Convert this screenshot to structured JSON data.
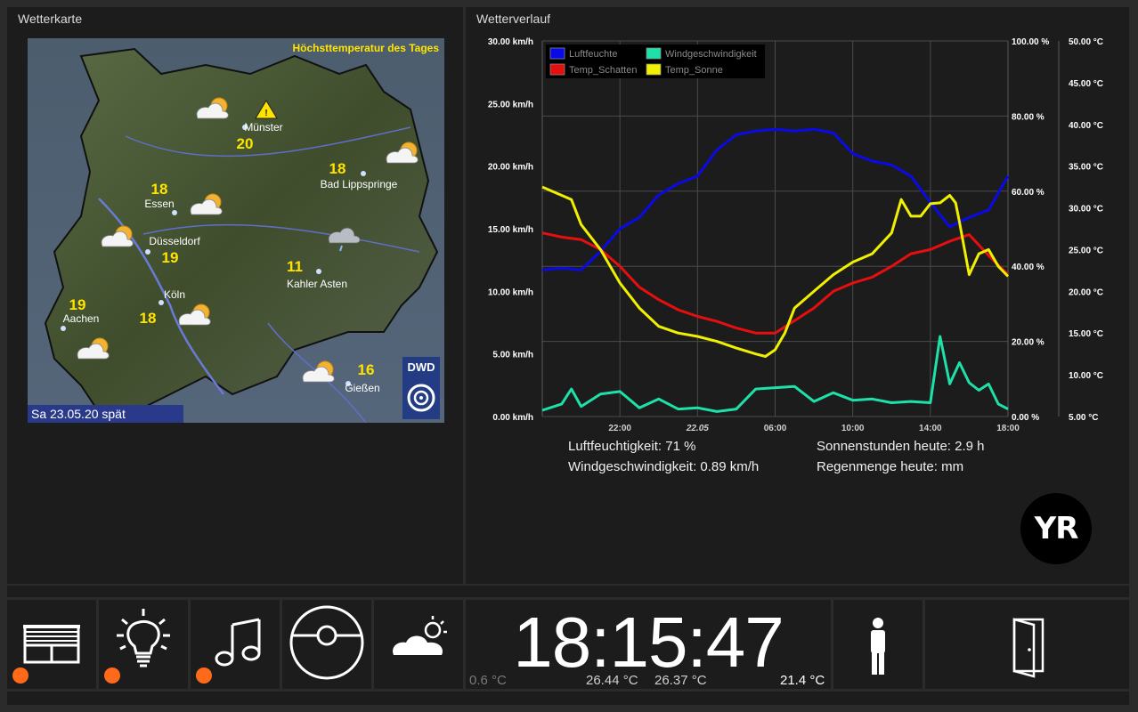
{
  "map_panel": {
    "title": "Wetterkarte",
    "map": {
      "header": "Höchsttemperatur des Tages",
      "date_label": "Sa 23.05.20 spät",
      "provider_badge": "DWD",
      "cities": [
        {
          "name": "Münster",
          "temp": "20",
          "icon": "partly-cloudy-icon"
        },
        {
          "name": "Bad Lippspringe",
          "temp": "18",
          "icon": "partly-cloudy-icon"
        },
        {
          "name": "Essen",
          "temp": "18",
          "icon": "partly-cloudy-icon"
        },
        {
          "name": "Düsseldorf",
          "temp": "19",
          "icon": "partly-cloudy-icon"
        },
        {
          "name": "Kahler Asten",
          "temp": "11",
          "icon": "rain-cloud-icon"
        },
        {
          "name": "Köln",
          "temp": "18",
          "icon": "partly-cloudy-icon"
        },
        {
          "name": "Aachen",
          "temp": "19",
          "icon": "partly-cloudy-icon"
        },
        {
          "name": "Gießen",
          "temp": "16",
          "icon": "partly-cloudy-icon"
        }
      ]
    }
  },
  "chart_panel": {
    "title": "Wetterverlauf",
    "stats": {
      "humidity": "Luftfeuchtigkeit: 71 %",
      "wind": "Windgeschwindigkeit: 0.89 km/h",
      "sun": "Sonnenstunden heute: 2.9 h",
      "rain": "Regenmenge heute: mm"
    },
    "logo": "YR"
  },
  "chart_data": {
    "type": "line",
    "grid": true,
    "legend_position": "top-left",
    "x_domain": [
      0,
      24
    ],
    "x_tick_labels": [
      "22:00",
      "22.05",
      "06:00",
      "10:00",
      "14:00",
      "18:00"
    ],
    "x_tick_positions": [
      4.0,
      8.0,
      12.0,
      16.0,
      20.0,
      24.0
    ],
    "y_axes": {
      "wind": {
        "range": [
          0,
          30
        ],
        "ticks": [
          "0.00 km/h",
          "5.00 km/h",
          "10.00 km/h",
          "15.00 km/h",
          "20.00 km/h",
          "25.00 km/h",
          "30.00 km/h"
        ]
      },
      "humidity": {
        "range": [
          0,
          100
        ],
        "ticks": [
          "0.00 %",
          "20.00 %",
          "40.00 %",
          "60.00 %",
          "80.00 %",
          "100.00 %"
        ]
      },
      "temperature": {
        "range": [
          5,
          50
        ],
        "ticks": [
          "5.00 °C",
          "10.00 °C",
          "15.00 °C",
          "20.00 °C",
          "25.00 °C",
          "30.00 °C",
          "35.00 °C",
          "40.00 °C",
          "45.00 °C",
          "50.00 °C"
        ]
      }
    },
    "series": [
      {
        "name": "Luftfeuchte",
        "color": "#0a0ae6",
        "axis": "humidity",
        "x": [
          0,
          1,
          2,
          3,
          4,
          5,
          6,
          7,
          8,
          9,
          10,
          11,
          12,
          13,
          14,
          15,
          16,
          17,
          18,
          19,
          20,
          21,
          22,
          23,
          24
        ],
        "y": [
          39,
          39.5,
          39,
          44,
          50,
          53,
          59,
          62,
          64,
          71,
          75,
          76,
          76.5,
          76,
          76.5,
          75.5,
          70,
          68,
          67,
          64,
          57,
          50.5,
          53,
          55,
          64
        ]
      },
      {
        "name": "Temp_Schatten",
        "color": "#e60f0f",
        "axis": "temperature",
        "x": [
          0,
          1,
          2,
          3,
          4,
          5,
          6,
          7,
          8,
          9,
          10,
          11,
          12,
          13,
          14,
          15,
          16,
          17,
          18,
          19,
          20,
          21,
          22,
          23,
          24
        ],
        "y": [
          27,
          26.5,
          26.2,
          25,
          23,
          20.5,
          19,
          17.8,
          17,
          16.4,
          15.6,
          15,
          15,
          16.5,
          18,
          20,
          21,
          21.7,
          23,
          24.5,
          25,
          26,
          26.8,
          24.3,
          22
        ]
      },
      {
        "name": "Temp_Sonne",
        "color": "#f0f000",
        "axis": "temperature",
        "x": [
          0,
          1,
          1.5,
          2,
          3,
          4,
          5,
          6,
          7,
          8,
          9,
          10,
          11,
          11.5,
          12,
          12.5,
          13,
          14,
          15,
          16,
          17,
          18,
          18.5,
          19,
          19.5,
          20,
          20.5,
          21,
          21.3,
          21.5,
          22,
          22.5,
          23,
          23.5,
          24
        ],
        "y": [
          32.5,
          31.5,
          31,
          28,
          25,
          21,
          18,
          15.8,
          15,
          14.6,
          14,
          13.2,
          12.5,
          12.2,
          13,
          15,
          18,
          20,
          22,
          23.5,
          24.5,
          27,
          31,
          29,
          29,
          30.5,
          30.6,
          31.5,
          30.6,
          28.3,
          22,
          24.5,
          25,
          23,
          21.8
        ]
      },
      {
        "name": "Windgeschwindigkeit",
        "color": "#1ee1aa",
        "axis": "wind",
        "x": [
          0,
          1,
          1.5,
          2,
          3,
          4,
          5,
          6,
          7,
          8,
          9,
          10,
          11,
          12,
          13,
          14,
          15,
          16,
          17,
          18,
          19,
          20,
          20.5,
          21,
          21.5,
          22,
          22.5,
          23,
          23.5,
          24
        ],
        "y": [
          0.5,
          1,
          2.2,
          0.8,
          1.8,
          2,
          0.7,
          1.4,
          0.6,
          0.7,
          0.4,
          0.6,
          2.2,
          2.3,
          2.4,
          1.2,
          1.9,
          1.3,
          1.4,
          1.1,
          1.2,
          1.1,
          6.4,
          2.6,
          4.3,
          2.7,
          2.1,
          2.6,
          1.0,
          0.6
        ]
      }
    ]
  },
  "dock": {
    "tiles": [
      {
        "name": "blinds",
        "icon": "blinds-icon",
        "has_indicator": true
      },
      {
        "name": "lights",
        "icon": "lightbulb-icon",
        "has_indicator": true
      },
      {
        "name": "music",
        "icon": "music-note-icon",
        "has_indicator": true
      },
      {
        "name": "vacuum",
        "icon": "robot-vacuum-icon",
        "has_indicator": false
      },
      {
        "name": "weather",
        "icon": "weather-cloud-sun-icon",
        "has_indicator": false
      }
    ],
    "clock": {
      "time": "18:15:47",
      "outdoor_temp": "0.6 °C",
      "temp_a": "26.44 °C",
      "temp_b": "26.37 °C",
      "indoor_temp": "21.4 °C"
    },
    "presence_icon": "person-icon",
    "door_icon": "door-icon"
  }
}
